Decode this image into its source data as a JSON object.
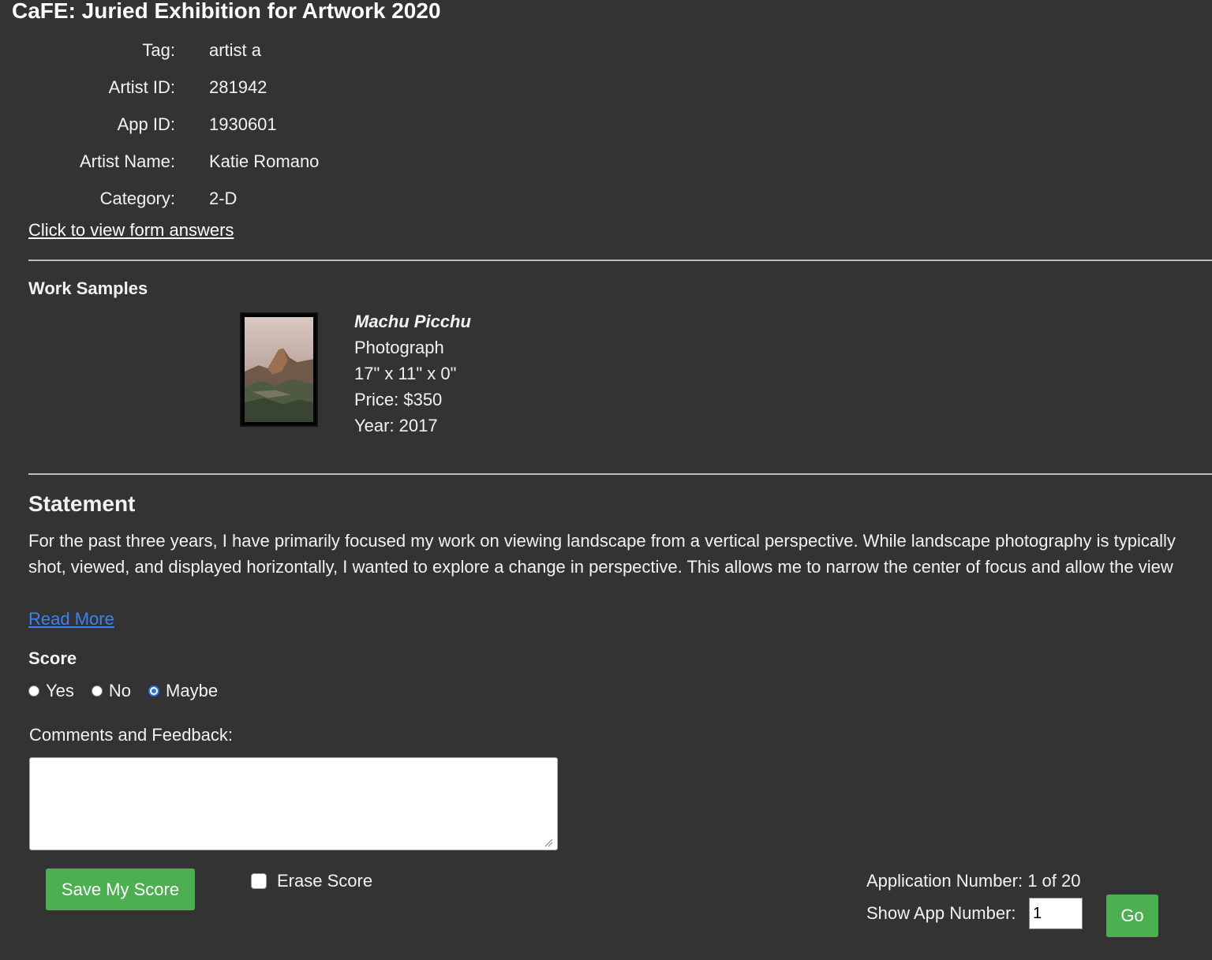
{
  "page": {
    "title": "CaFE: Juried Exhibition for Artwork 2020"
  },
  "info": {
    "tag": {
      "label": "Tag:",
      "value": "artist a"
    },
    "artist_id": {
      "label": "Artist ID:",
      "value": "281942"
    },
    "app_id": {
      "label": "App ID:",
      "value": "1930601"
    },
    "artist_name": {
      "label": "Artist Name:",
      "value": "Katie Romano"
    },
    "category": {
      "label": "Category:",
      "value": "2-D"
    },
    "form_link": "Click to view form answers"
  },
  "work_samples": {
    "heading": "Work Samples",
    "items": [
      {
        "title": "Machu Picchu",
        "medium": "Photograph",
        "dimensions": "17\" x 11\" x 0\"",
        "price": "Price: $350",
        "year": "Year: 2017",
        "thumbnail_icon": "mountain-photo-thumbnail"
      }
    ]
  },
  "statement": {
    "heading": "Statement",
    "text": "For the past three years, I have primarily focused my work on viewing landscape from a vertical perspective. While landscape photography is typically shot, viewed, and displayed horizontally, I wanted to explore a change in perspective. This allows me to narrow the center of focus and allow the view",
    "read_more": "Read More"
  },
  "score": {
    "heading": "Score",
    "options": [
      {
        "label": "Yes",
        "checked": false
      },
      {
        "label": "No",
        "checked": false
      },
      {
        "label": "Maybe",
        "checked": true
      }
    ],
    "selected": "Maybe"
  },
  "comments": {
    "label": "Comments and Feedback:",
    "value": ""
  },
  "actions": {
    "save_label": "Save My Score",
    "erase_label": "Erase Score",
    "erase_checked": false
  },
  "navigation": {
    "app_number_text": "Application Number: 1 of 20",
    "show_app_label": "Show App Number:",
    "show_app_value": "1",
    "go_label": "Go"
  },
  "colors": {
    "background": "#333333",
    "text": "#f2f2f2",
    "accent_green": "#4caf50",
    "link_blue": "#3b82f6",
    "radio_selected": "#2f6fe4"
  }
}
